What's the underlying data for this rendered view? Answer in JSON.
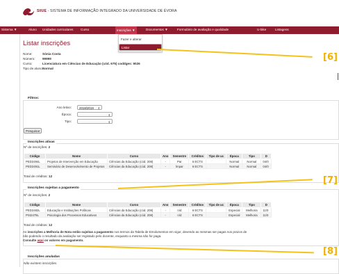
{
  "header": {
    "system_name": "SIIUE",
    "system_subtitle": "- SISTEMA DE INFORMAÇÃO INTEGRADO DA UNIVERSIDADE DE ÉVORA"
  },
  "nav": {
    "items": [
      "Sistema ▼",
      "Aluno",
      "Unidades curriculares",
      "Curso",
      "Inscrições ▼",
      "Documentos ▼",
      "Formulário de avaliação e qualidade",
      "U-bike",
      "Listagens"
    ],
    "dropdown": [
      "Fazer e alterar",
      "Listar"
    ]
  },
  "page": {
    "title": "Listar inscrições",
    "fields": [
      {
        "label": "Nome:",
        "value": "Sónia Costa"
      },
      {
        "label": "Número:",
        "value": "99999"
      },
      {
        "label": "Curso:",
        "value_bold": "Licenciatura",
        "value_rest": " em Ciências de Educação (cód. 675) coddges: 9026"
      },
      {
        "label": "Tipo de aluno:",
        "value": "Normal"
      }
    ]
  },
  "filters": {
    "legend": "Filtros:",
    "ano_label": "Ano letivo:",
    "ano_value": "2018/2019",
    "epoca_label": "Época:",
    "epoca_value": "",
    "tipo_label": "Tipo:",
    "tipo_value": "",
    "search_button": "Pesquisar"
  },
  "section_active": {
    "legend": "Inscrições ativas",
    "count_label": "Nº de inscrições:",
    "count": "2",
    "headers": [
      "Código",
      "Nome",
      "Curso",
      "Ano",
      "Semestre",
      "Créditos",
      "Tipo de uc",
      "Época",
      "Tipo",
      "D"
    ],
    "rows": [
      [
        "PED2494L",
        "Projetos de Intervenção em Educação",
        "Ciências da Educação (cód. 208)",
        "-",
        "Par",
        "6 ECTS",
        "",
        "Normal",
        "Normal",
        "04/0"
      ],
      [
        "PED2491L",
        "Seminário de Desenvolvimento de Projetos",
        "Ciências da Educação (cód. 208)",
        "-",
        "Ímpar",
        "6 ECTS",
        "",
        "Normal",
        "Normal",
        "04/0"
      ]
    ],
    "total_label": "Total de créditos:",
    "total": "12"
  },
  "section_payment": {
    "legend": "Inscrições sujeitas a pagamento",
    "count_label": "Nº de inscrições:",
    "count": "2",
    "headers": [
      "Código",
      "Nome",
      "Curso",
      "Ano",
      "Semestre",
      "Créditos",
      "Tipo de uc",
      "Época",
      "Tipo",
      "D"
    ],
    "rows": [
      [
        "PED2482L",
        "Educação e Instituições Políticas",
        "Ciências da Educação (cód. 208)",
        "-",
        "n/d",
        "6 ECTS",
        "",
        "Especial",
        "Melhoria",
        "11/0"
      ],
      [
        "PSI2479L",
        "Psicologia dos Processos Educativos",
        "Ciências da Educação (cód. 208)",
        "-",
        "n/d",
        "6 ECTS",
        "",
        "Especial",
        "Melhoria",
        "11/0"
      ]
    ],
    "total_label": "Total de créditos:",
    "total": "12",
    "note_1a": "As ",
    "note_1b": "inscrições a Melhoria de Nota estão sujeitas a pagamento",
    "note_1c": " nos termos da Tabela de Emolumentos em vigor, devendo as mesmas ser pagas nos prazos de",
    "note_2": "não podendo o resultado da avaliação ser registado pelo docente, enquanto a mesma não for paga.",
    "note_3a": "Consulte ",
    "note_3_link": "aqui",
    "note_3b": " os valores em pagamento."
  },
  "section_cancelled": {
    "legend": "Inscrições anuladas",
    "empty": "Não existem inscrições."
  },
  "callouts": {
    "c6": "[6]",
    "c7": "[7]",
    "c8": "[8]"
  },
  "colors": {
    "brand": "#8e1b2e",
    "callout": "#f6c21a"
  }
}
